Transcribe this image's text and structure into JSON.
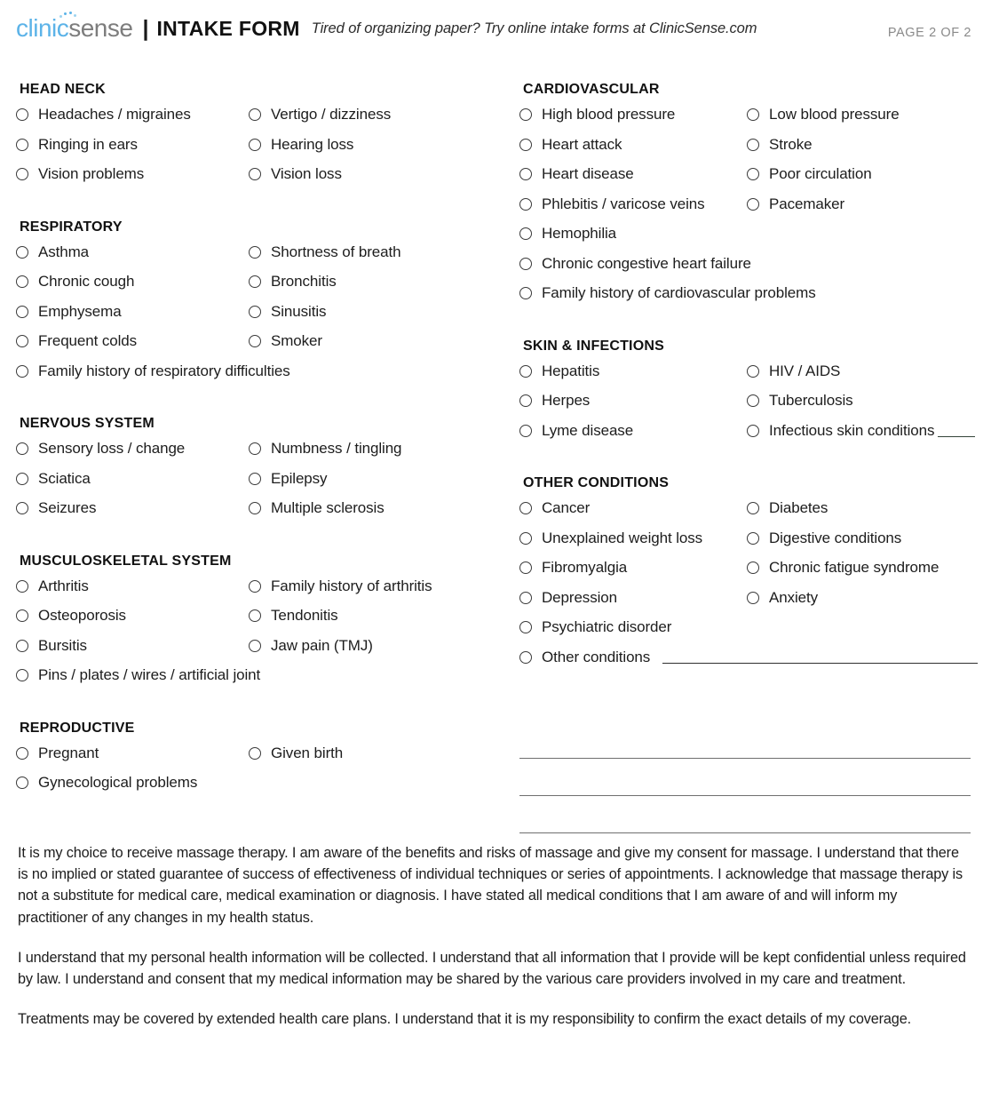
{
  "header": {
    "logo_clinic": "clinic",
    "logo_sense": "sense",
    "divider": "|",
    "title": "INTAKE FORM",
    "tagline": "Tired of organizing paper? Try online intake forms at ClinicSense.com",
    "page_label": "PAGE 2 OF 2",
    "brand_blue": "#5cb3e8",
    "brand_gray": "#7d7d7d"
  },
  "left_column": [
    {
      "title": "HEAD NECK",
      "rows": [
        [
          "Headaches / migraines",
          "Vertigo / dizziness"
        ],
        [
          "Ringing in ears",
          "Hearing loss"
        ],
        [
          "Vision problems",
          "Vision loss"
        ]
      ]
    },
    {
      "title": "RESPIRATORY",
      "rows": [
        [
          "Asthma",
          "Shortness of breath"
        ],
        [
          "Chronic cough",
          "Bronchitis"
        ],
        [
          "Emphysema",
          "Sinusitis"
        ],
        [
          "Frequent colds",
          "Smoker"
        ],
        [
          "Family history of respiratory difficulties"
        ]
      ]
    },
    {
      "title": "NERVOUS SYSTEM",
      "rows": [
        [
          "Sensory loss / change",
          "Numbness / tingling"
        ],
        [
          "Sciatica",
          "Epilepsy"
        ],
        [
          "Seizures",
          "Multiple sclerosis"
        ]
      ]
    },
    {
      "title": "MUSCULOSKELETAL SYSTEM",
      "rows": [
        [
          "Arthritis",
          "Family history of arthritis"
        ],
        [
          "Osteoporosis",
          "Tendonitis"
        ],
        [
          "Bursitis",
          "Jaw pain (TMJ)"
        ],
        [
          "Pins / plates / wires / artificial joint"
        ]
      ]
    },
    {
      "title": "REPRODUCTIVE",
      "rows": [
        [
          "Pregnant",
          "Given birth"
        ],
        [
          "Gynecological problems"
        ]
      ]
    }
  ],
  "right_column": [
    {
      "title": "CARDIOVASCULAR",
      "rows": [
        [
          "High blood pressure",
          "Low blood pressure"
        ],
        [
          "Heart attack",
          "Stroke"
        ],
        [
          "Heart disease",
          "Poor circulation"
        ],
        [
          "Phlebitis / varicose veins",
          "Pacemaker"
        ],
        [
          "Hemophilia"
        ],
        [
          "Chronic congestive heart failure"
        ],
        [
          "Family history of cardiovascular problems"
        ]
      ]
    },
    {
      "title": "SKIN & INFECTIONS",
      "rows": [
        [
          "Hepatitis",
          "HIV / AIDS"
        ],
        [
          "Herpes",
          "Tuberculosis"
        ],
        [
          "Lyme disease",
          "Infectious skin conditions"
        ]
      ]
    },
    {
      "title": "OTHER CONDITIONS",
      "rows": [
        [
          "Cancer",
          "Diabetes"
        ],
        [
          "Unexplained weight loss",
          "Digestive conditions"
        ],
        [
          "Fibromyalgia",
          "Chronic fatigue syndrome"
        ],
        [
          "Depression",
          "Anxiety"
        ],
        [
          "Psychiatric disorder"
        ],
        [
          "Other conditions"
        ]
      ]
    }
  ],
  "write_in": {
    "other_conditions_value": "",
    "infectious_skin_value": "",
    "blank_line_count": 3,
    "blank_values": [
      "",
      "",
      ""
    ]
  },
  "consent": {
    "paragraphs": [
      "It is my choice to receive massage therapy. I am aware of the benefits and risks of massage and give my consent for massage. I understand that there is no implied or stated guarantee of success of effectiveness of individual techniques or series of appointments. I acknowledge that massage therapy is not a substitute for medical care, medical examination or diagnosis. I have stated all medical conditions that I am aware of and will inform my practitioner of any changes in my health status.",
      "I understand that my personal health information will be collected. I understand that all information that I provide will be kept confidential unless required by law. I understand and consent that my medical information may be shared by the various care providers involved in my care and treatment.",
      "Treatments may be covered by extended health care plans. I understand that it is my responsibility to confirm the exact details of my coverage."
    ]
  }
}
